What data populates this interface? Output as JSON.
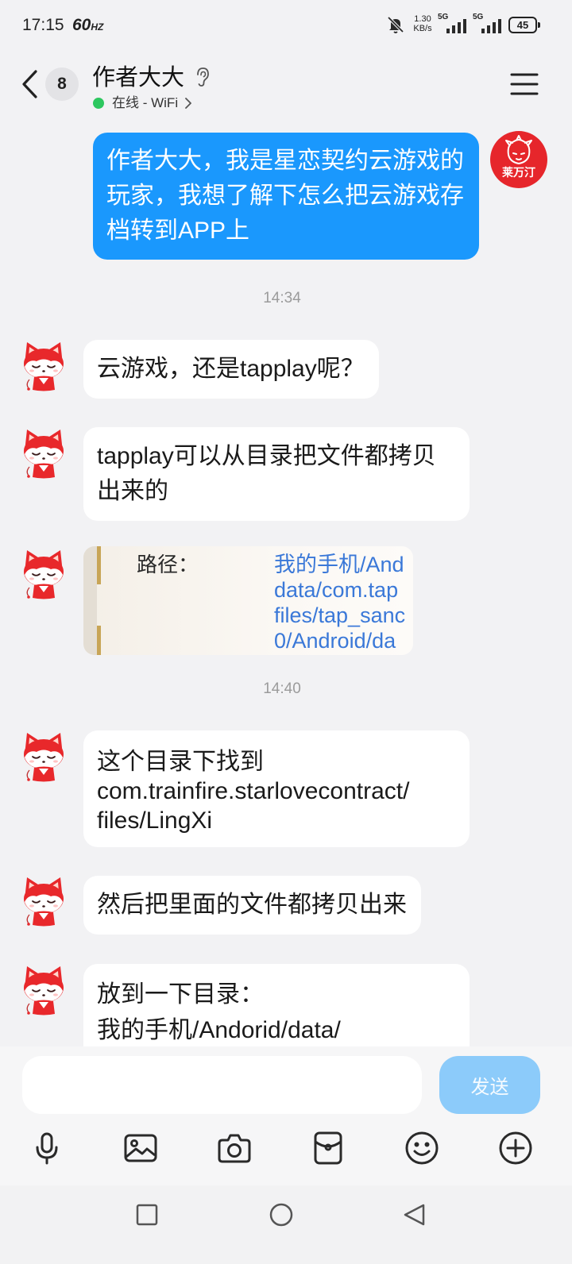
{
  "status_bar": {
    "time": "17:15",
    "refresh_rate": "60",
    "refresh_unit": "HZ",
    "net_speed": "1.30",
    "net_speed_unit": "KB/s",
    "sim1_network": "5G",
    "sim2_network": "5G",
    "battery_level": "45",
    "icons": [
      "mute-bell-icon",
      "signal-icon",
      "signal-icon",
      "battery-icon"
    ]
  },
  "header": {
    "unread_count": "8",
    "title": "作者大大",
    "status": "在线 - WiFi",
    "icons": [
      "chevron-left-icon",
      "ear-icon",
      "chevron-right-icon",
      "menu-icon"
    ]
  },
  "self_avatar_label": "莱万汀",
  "chat": [
    {
      "sent": [
        "作者大大，我是星恋契约云游戏的",
        "玩家，我想了解下怎么把云游戏存",
        "档转到APP上"
      ]
    },
    {
      "time": "14:34"
    },
    {
      "received": [
        "云游戏，还是tapplay呢？"
      ]
    },
    {
      "received": [
        "tapplay可以从目录把文件都拷贝",
        "出来的"
      ]
    },
    {
      "received_image": {
        "label": "路径：",
        "path_lines": [
          "我的手机/And",
          "data/com.tap",
          "files/tap_sanc",
          "0/Android/da"
        ]
      }
    },
    {
      "time": "14:40"
    },
    {
      "received": [
        "这个目录下找到",
        "com.trainfire.starlovecontract/",
        "files/LingXi"
      ]
    },
    {
      "received": [
        "然后把里面的文件都拷贝出来"
      ]
    },
    {
      "received": [
        "放到一下目录：",
        "我的手机/Andorid/data/"
      ]
    }
  ],
  "input": {
    "value": "",
    "send_label": "发送",
    "send_enabled": false
  },
  "toolbar": {
    "icons": [
      "microphone-icon",
      "image-icon",
      "camera-icon",
      "red-packet-icon",
      "emoji-icon",
      "plus-icon"
    ]
  },
  "nav_bar": {
    "icons": [
      "recent-apps-icon",
      "home-icon",
      "back-triangle-icon"
    ]
  },
  "colors": {
    "chat_background": "#f2f2f4",
    "outgoing_bubble": "#1a98fd",
    "incoming_bubble": "#ffffff",
    "send_button": "#8ccbfa",
    "online_dot": "#2dc75f",
    "link_text": "#3a78d8"
  }
}
